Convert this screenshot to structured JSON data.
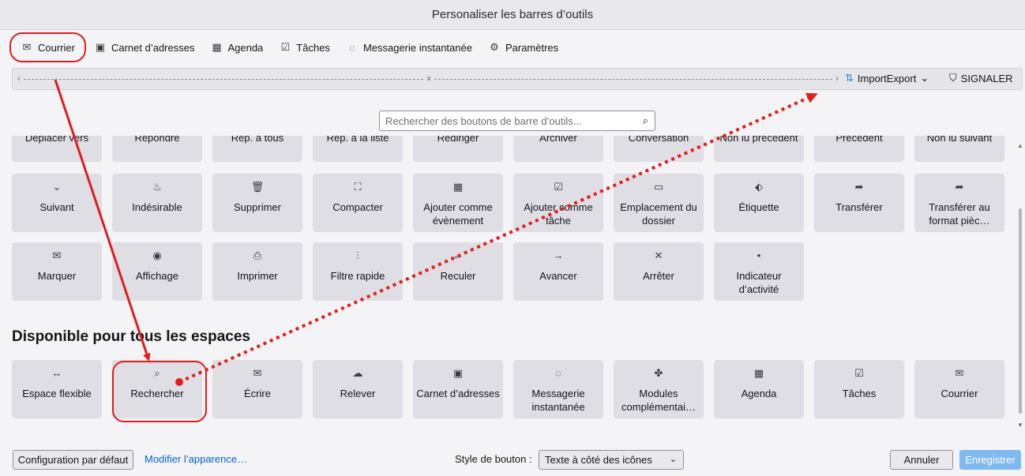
{
  "window": {
    "title": "Personaliser les barres d’outils"
  },
  "tabs": [
    {
      "label": "Courrier",
      "icon": "mail-icon",
      "glyph": "✉",
      "active": true
    },
    {
      "label": "Carnet d’adresses",
      "icon": "address-book-icon",
      "glyph": "▣"
    },
    {
      "label": "Agenda",
      "icon": "calendar-icon",
      "glyph": "▦"
    },
    {
      "label": "Tâches",
      "icon": "tasks-icon",
      "glyph": "☑"
    },
    {
      "label": "Messagerie instantanée",
      "icon": "chat-icon",
      "glyph": "◌"
    },
    {
      "label": "Paramètres",
      "icon": "gear-icon",
      "glyph": "⚙"
    }
  ],
  "toolbar_preview": {
    "importexport": {
      "label": "ImportExport",
      "icon": "importexport-icon",
      "glyph": "⇅"
    },
    "signaler": {
      "label": "SIGNALER",
      "icon": "report-icon",
      "glyph": "⛉"
    }
  },
  "search": {
    "placeholder": "Rechercher des boutons de barre d’outils...",
    "value": ""
  },
  "palette_rows": [
    [
      {
        "label": "Déplacer vers",
        "icon": "move-icon",
        "glyph": ""
      },
      {
        "label": "Répondre",
        "icon": "reply-icon",
        "glyph": ""
      },
      {
        "label": "Rép. à tous",
        "icon": "reply-all-icon",
        "glyph": ""
      },
      {
        "label": "Rép. à la liste",
        "icon": "reply-list-icon",
        "glyph": ""
      },
      {
        "label": "Rediriger",
        "icon": "redirect-icon",
        "glyph": ""
      },
      {
        "label": "Archiver",
        "icon": "archive-icon",
        "glyph": ""
      },
      {
        "label": "Conversation",
        "icon": "conversation-icon",
        "glyph": ""
      },
      {
        "label": "Non lu précédent",
        "icon": "previous-unread-icon",
        "glyph": ""
      },
      {
        "label": "Précédent",
        "icon": "previous-icon",
        "glyph": ""
      },
      {
        "label": "Non lu suivant",
        "icon": "next-unread-icon",
        "glyph": ""
      }
    ],
    [
      {
        "label": "Suivant",
        "icon": "chevron-down-icon",
        "glyph": "⌄"
      },
      {
        "label": "Indésirable",
        "icon": "junk-icon",
        "glyph": "♨"
      },
      {
        "label": "Supprimer",
        "icon": "trash-icon",
        "glyph": "🗑"
      },
      {
        "label": "Compacter",
        "icon": "compact-icon",
        "glyph": "⛶"
      },
      {
        "label": "Ajouter comme évènement",
        "icon": "add-event-icon",
        "glyph": "▦"
      },
      {
        "label": "Ajouter comme tâche",
        "icon": "add-task-icon",
        "glyph": "☑"
      },
      {
        "label": "Emplacement du dossier",
        "icon": "folder-icon",
        "glyph": "▭"
      },
      {
        "label": "Étiquette",
        "icon": "tag-icon",
        "glyph": "⬖"
      },
      {
        "label": "Transférer",
        "icon": "forward-icon",
        "glyph": "➦"
      },
      {
        "label": "Transférer au format pièc…",
        "icon": "forward-attachment-icon",
        "glyph": "➦"
      }
    ],
    [
      {
        "label": "Marquer",
        "icon": "mark-icon",
        "glyph": "✉"
      },
      {
        "label": "Affichage",
        "icon": "eye-icon",
        "glyph": "◉"
      },
      {
        "label": "Imprimer",
        "icon": "printer-icon",
        "glyph": "⎙"
      },
      {
        "label": "Filtre rapide",
        "icon": "filter-icon",
        "glyph": "⫶"
      },
      {
        "label": "Reculer",
        "icon": "back-arrow-icon",
        "glyph": "←"
      },
      {
        "label": "Avancer",
        "icon": "forward-arrow-icon",
        "glyph": "→"
      },
      {
        "label": "Arrêter",
        "icon": "stop-icon",
        "glyph": "✕"
      },
      {
        "label": "Indicateur d’activité",
        "icon": "activity-dot-icon",
        "glyph": "•"
      }
    ]
  ],
  "section_all_spaces": {
    "title": "Disponible pour tous les espaces",
    "items": [
      {
        "label": "Espace flexible",
        "icon": "flexible-space-icon",
        "glyph": "↔"
      },
      {
        "label": "Rechercher",
        "icon": "search-icon",
        "glyph": "⌕"
      },
      {
        "label": "Écrire",
        "icon": "write-icon",
        "glyph": "✉"
      },
      {
        "label": "Relever",
        "icon": "get-mail-icon",
        "glyph": "☁"
      },
      {
        "label": "Carnet d’adresses",
        "icon": "address-book-icon",
        "glyph": "▣"
      },
      {
        "label": "Messagerie instantanée",
        "icon": "chat-icon",
        "glyph": "◌"
      },
      {
        "label": "Modules complémentai…",
        "icon": "puzzle-icon",
        "glyph": "✤"
      },
      {
        "label": "Agenda",
        "icon": "calendar-icon",
        "glyph": "▦"
      },
      {
        "label": "Tâches",
        "icon": "tasks-icon",
        "glyph": "☑"
      },
      {
        "label": "Courrier",
        "icon": "mail-icon",
        "glyph": "✉"
      }
    ]
  },
  "footer": {
    "restore_default": "Configuration par défaut",
    "change_appearance": "Modifier l’apparence…",
    "button_style_label": "Style de bouton :",
    "button_style_value": "Texte à côté des icônes",
    "cancel": "Annuler",
    "save": "Enregistrer"
  },
  "colors": {
    "annotation_red": "#e21d1d",
    "link_blue": "#0061e0",
    "save_disabled": "#80b8f0"
  }
}
